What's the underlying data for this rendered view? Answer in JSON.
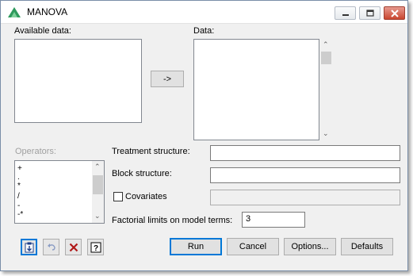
{
  "window": {
    "title": "MANOVA"
  },
  "available_data": {
    "label": "Available data:",
    "items": []
  },
  "transfer_button": {
    "label": "->"
  },
  "data": {
    "label": "Data:",
    "items": []
  },
  "operators": {
    "label": "Operators:",
    "items": [
      "+",
      ".",
      "*",
      "/",
      "-",
      "-*"
    ]
  },
  "treatment_structure": {
    "label": "Treatment structure:",
    "value": ""
  },
  "block_structure": {
    "label": "Block structure:",
    "value": ""
  },
  "covariates": {
    "label": "Covariates",
    "checked": false,
    "value": ""
  },
  "factorial_limits": {
    "label": "Factorial limits on model terms:",
    "value": "3"
  },
  "buttons": {
    "run": "Run",
    "cancel": "Cancel",
    "options": "Options...",
    "defaults": "Defaults"
  },
  "toolbar_icons": [
    "save-to-clipboard-icon",
    "undo-icon",
    "clear-icon",
    "help-icon"
  ],
  "colors": {
    "accent": "#0078d7",
    "close": "#c9462f"
  }
}
